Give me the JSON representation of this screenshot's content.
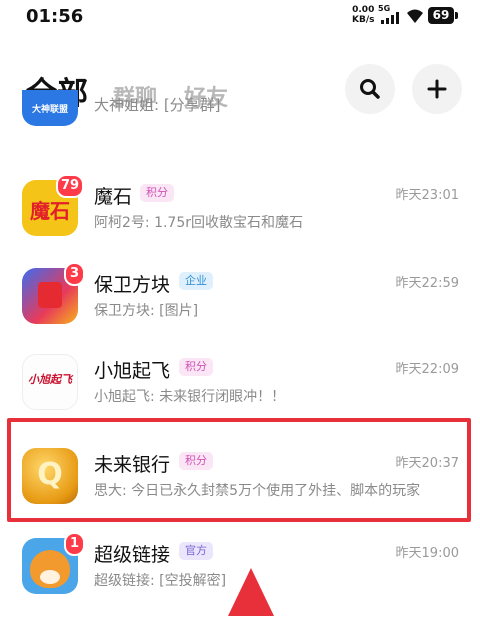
{
  "status_bar": {
    "time": "01:56",
    "net_speed_value": "0.00",
    "net_speed_unit": "KB/s",
    "network_type": "5G",
    "battery": "69"
  },
  "header": {
    "tabs": [
      {
        "label": "全部",
        "active": true
      },
      {
        "label": "群聊",
        "active": false
      },
      {
        "label": "好友",
        "active": false
      }
    ],
    "search_icon": "search-icon",
    "add_icon": "plus-icon"
  },
  "conversations": [
    {
      "name": "",
      "avatar_text": "大神联盟",
      "message": "大神姐姐: [分享群]",
      "tag": "",
      "time": "",
      "badge": ""
    },
    {
      "name": "魔石",
      "avatar_text": "魔石",
      "message": "阿柯2号: 1.75r回收散宝石和魔石",
      "tag": "积分",
      "time": "昨天23:01",
      "badge": "79"
    },
    {
      "name": "保卫方块",
      "avatar_text": "",
      "message": "保卫方块: [图片]",
      "tag": "企业",
      "time": "昨天22:59",
      "badge": "3"
    },
    {
      "name": "小旭起飞",
      "avatar_text": "小旭起飞",
      "message": "小旭起飞: 未来银行闭眼冲！！",
      "tag": "积分",
      "time": "昨天22:09",
      "badge": ""
    },
    {
      "name": "未来银行",
      "avatar_text": "Q",
      "message": "思大: 今日已永久封禁5万个使用了外挂、脚本的玩家",
      "tag": "积分",
      "time": "昨天20:37",
      "badge": ""
    },
    {
      "name": "超级链接",
      "avatar_text": "",
      "message": "超级链接: [空投解密]",
      "tag": "官方",
      "time": "昨天19:00",
      "badge": "1"
    }
  ],
  "colors": {
    "highlight": "#e8303a",
    "badge": "#ff3b4a",
    "score_tag": "#d152b6",
    "enterprise_tag": "#2f90d8",
    "official_tag": "#7a63d6"
  }
}
